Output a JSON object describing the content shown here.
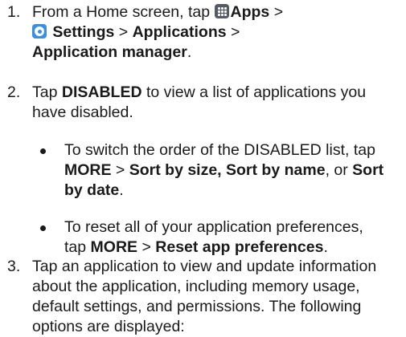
{
  "steps": [
    {
      "number": "1.",
      "line1_prefix": "From a Home screen, tap",
      "apps_label": "Apps",
      "gt": ">",
      "settings_label": "Settings",
      "applications_label": "Applications",
      "app_manager_label": "Application manager",
      "period": "."
    },
    {
      "number": "2.",
      "tap": "Tap",
      "disabled_label": "DISABLED",
      "text_rest1": "to view a list of applications you",
      "text_rest2": "have disabled.",
      "bullets": [
        {
          "t1": "To switch the order of the DISABLED list, tap",
          "more": "MORE",
          "gt": ">",
          "opt1": "Sort by size, Sort by name",
          "or": ", or",
          "opt2a": "Sort",
          "opt2b": "by date",
          "period": "."
        },
        {
          "t1": "To reset all of your application preferences,",
          "tap": "tap",
          "more": "MORE",
          "gt": ">",
          "reset": "Reset app preferences",
          "period": "."
        }
      ]
    },
    {
      "number": "3.",
      "lines": [
        "Tap an application to view and update information",
        "about the application, including memory usage,",
        "default settings, and permissions. The following",
        "options are displayed:"
      ]
    }
  ],
  "colors": {
    "text": "#1a1a1a",
    "apps_icon": "#555a63",
    "settings_icon": "#3a8fe0"
  },
  "icons": {
    "apps": "apps-grid-icon",
    "settings": "settings-gear-icon"
  }
}
